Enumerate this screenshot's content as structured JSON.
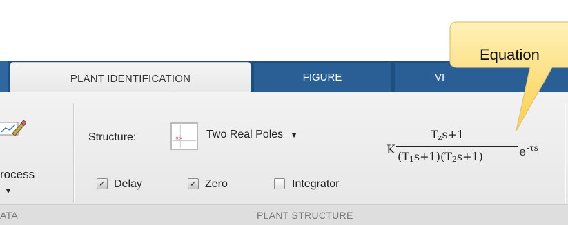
{
  "tabs": {
    "active": "PLANT IDENTIFICATION",
    "figure": "FIGURE",
    "view": "VI"
  },
  "data_section": {
    "process_label": "rocess",
    "section_label": "ATA"
  },
  "plant_structure": {
    "structure_label": "Structure:",
    "structure_value": "Two Real Poles",
    "section_label": "PLANT STRUCTURE",
    "checkboxes": [
      {
        "label": "Delay",
        "checked": true
      },
      {
        "label": "Zero",
        "checked": true
      },
      {
        "label": "Integrator",
        "checked": false
      }
    ]
  },
  "equation": {
    "gain": "K",
    "numerator": {
      "main": "T",
      "sub": "z",
      "rest": "s+1"
    },
    "denominator": {
      "p1": "(T",
      "s1": "1",
      "p2": "s+1)(T",
      "s2": "2",
      "p3": "s+1)"
    },
    "exp_base": "e",
    "exp_power": "-τs"
  },
  "callout": {
    "text": "Equation",
    "color": "#fbd966"
  },
  "colors": {
    "tab_bar": "#1d4f80",
    "tab_inactive": "#2a5f96",
    "toolstrip": "#ececec"
  }
}
